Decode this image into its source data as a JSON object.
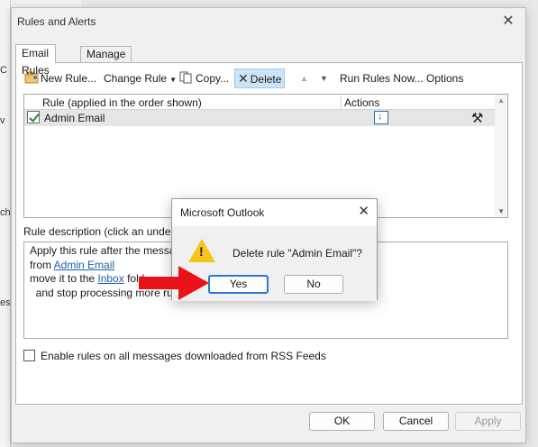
{
  "background": {
    "fragments": [
      "C",
      "v",
      "ch",
      "es,"
    ]
  },
  "dialog": {
    "title": "Rules and Alerts",
    "close_glyph": "✕",
    "tabs": [
      {
        "label": "Email Rules",
        "active": true
      },
      {
        "label": "Manage Alerts",
        "active": false
      }
    ]
  },
  "toolbar": {
    "new_rule": "New Rule...",
    "change_rule": "Change Rule",
    "copy": "Copy...",
    "delete": "Delete",
    "run_rules_now": "Run Rules Now...",
    "options": "Options"
  },
  "rule_list": {
    "col_rule": "Rule (applied in the order shown)",
    "col_actions": "Actions",
    "rows": [
      {
        "name": "Admin Email",
        "enabled": true
      }
    ]
  },
  "description": {
    "label": "Rule description (click an underl",
    "line1": "Apply this rule after the messag",
    "line2_prefix": "from ",
    "line2_link": "Admin Email",
    "line3_prefix": "move it to the ",
    "line3_link": "Inbox",
    "line3_suffix": " fold",
    "line4": "  and stop processing more rul"
  },
  "rss_checkbox": {
    "label": "Enable rules on all messages downloaded from RSS Feeds",
    "checked": false
  },
  "footer": {
    "ok": "OK",
    "cancel": "Cancel",
    "apply": "Apply"
  },
  "confirm": {
    "title": "Microsoft Outlook",
    "message": "Delete rule \"Admin Email\"?",
    "yes": "Yes",
    "no": "No",
    "close_glyph": "✕"
  },
  "colors": {
    "arrow": "#e8141a",
    "warning": "#f5c518",
    "link": "#1f5da8",
    "focus": "#2b79d0"
  }
}
